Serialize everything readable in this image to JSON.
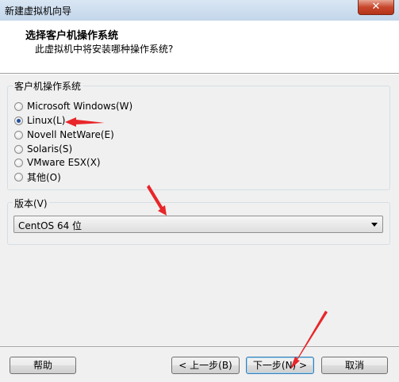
{
  "window": {
    "title": "新建虚拟机向导",
    "close_label": "✕"
  },
  "header": {
    "title": "选择客户机操作系统",
    "subtitle": "此虚拟机中将安装哪种操作系统?"
  },
  "os_group": {
    "title": "客户机操作系统",
    "options": [
      {
        "label": "Microsoft Windows(W)",
        "checked": false
      },
      {
        "label": "Linux(L)",
        "checked": true
      },
      {
        "label": "Novell NetWare(E)",
        "checked": false
      },
      {
        "label": "Solaris(S)",
        "checked": false
      },
      {
        "label": "VMware ESX(X)",
        "checked": false
      },
      {
        "label": "其他(O)",
        "checked": false
      }
    ]
  },
  "version_group": {
    "title": "版本(V)",
    "selected": "CentOS 64 位"
  },
  "buttons": {
    "help": "帮助",
    "back": "< 上一步(B)",
    "next": "下一步(N) >",
    "cancel": "取消"
  },
  "colors": {
    "annotation_arrow": "#e8262a",
    "accent": "#3c7fb1"
  }
}
